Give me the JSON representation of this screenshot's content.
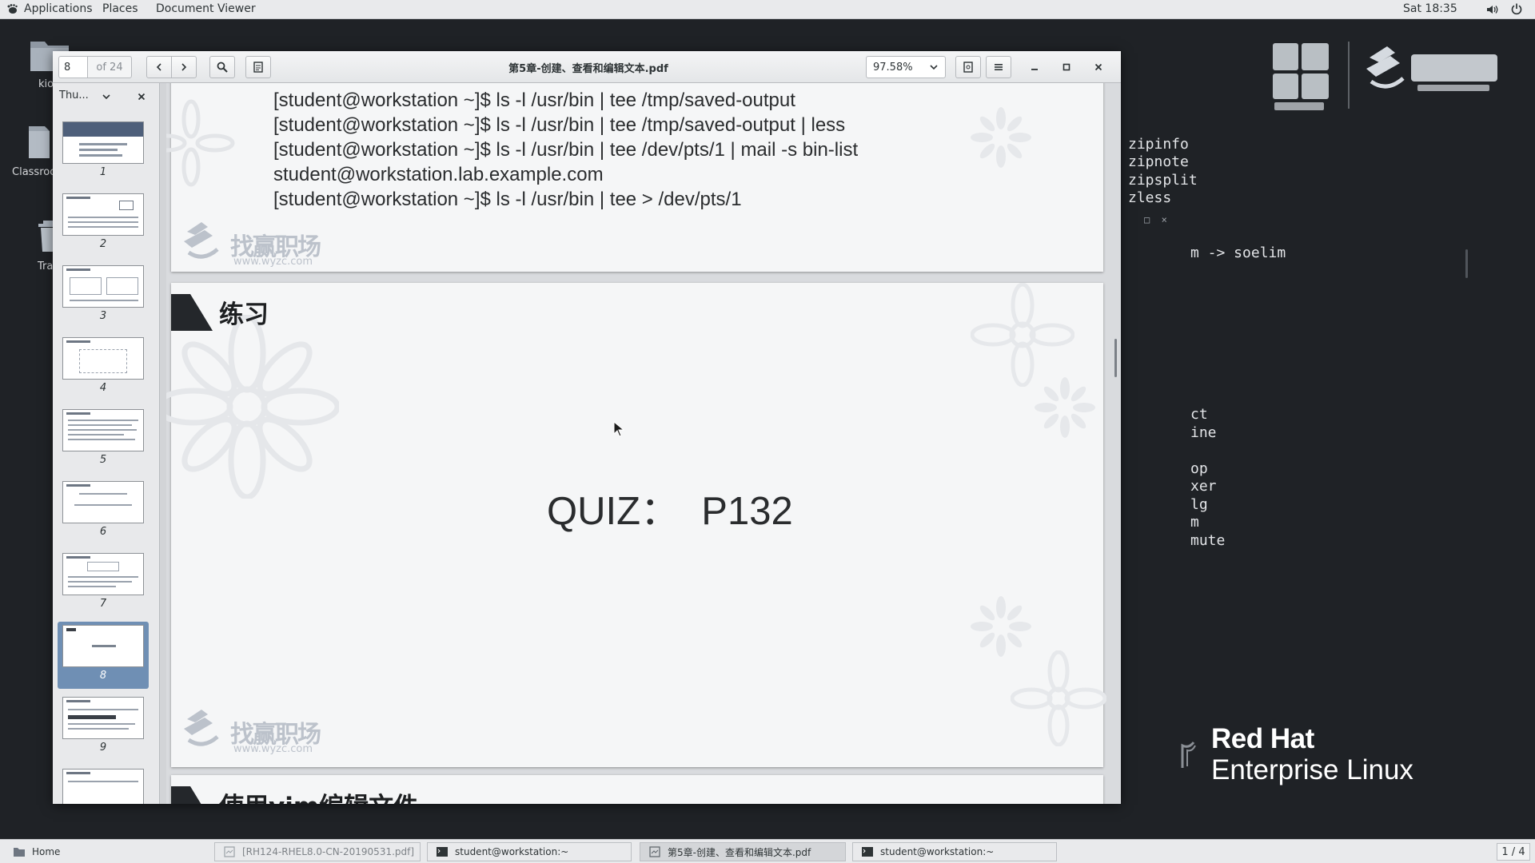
{
  "topbar": {
    "applications": "Applications",
    "places": "Places",
    "app_menu": "Document Viewer",
    "clock": "Sat 18:35"
  },
  "desktop": {
    "icons": [
      {
        "label": "kio"
      },
      {
        "label": "Classroo"
      },
      {
        "label": "Tra"
      }
    ]
  },
  "terminal_bg": {
    "lines": [
      "zipinfo",
      "zipnote",
      "zipsplit",
      "zless",
      "□  ×",
      "m -> soelim",
      "ct",
      "ine",
      "op",
      "xer",
      "lg",
      "m",
      "mute"
    ]
  },
  "branding": {
    "rh_title": "Red Hat",
    "rh_subtitle": "Enterprise Linux"
  },
  "viewer": {
    "page_current": "8",
    "page_of": "of 24",
    "title": "第5章-创建、查看和编辑文本.pdf",
    "zoom": "97.58%",
    "sidebar_mode": "Thu...",
    "thumbnails": [
      "1",
      "2",
      "3",
      "4",
      "5",
      "6",
      "7",
      "8",
      "9"
    ],
    "selected_thumbnail": "8"
  },
  "document": {
    "commands": [
      "[student@workstation ~]$ ls -l /usr/bin | tee /tmp/saved-output",
      "[student@workstation ~]$ ls -l /usr/bin | tee /tmp/saved-output | less",
      " [student@workstation ~]$ ls -l /usr/bin | tee /dev/pts/1 | mail -s bin-list",
      "student@workstation.lab.example.com",
      "[student@workstation ~]$ ls -l /usr/bin | tee > /dev/pts/1"
    ],
    "watermark_name": "找赢职场",
    "watermark_url": "www.wyzc.com",
    "section_title": "练习",
    "quiz": "QUIZ：  P132",
    "next_section_title": "使用vim编辑文件"
  },
  "taskbar": {
    "home": "Home",
    "task_pdf1": "[RH124-RHEL8.0-CN-20190531.pdf]",
    "task_term1": "student@workstation:~",
    "task_pdf2": "第5章-创建、查看和编辑文本.pdf",
    "task_term2": "student@workstation:~",
    "workspace": "1 / 4"
  },
  "colors": {
    "desktop_bg": "#1f2226",
    "panel_bg": "#e9eaec",
    "selection": "#6f8fb4"
  }
}
